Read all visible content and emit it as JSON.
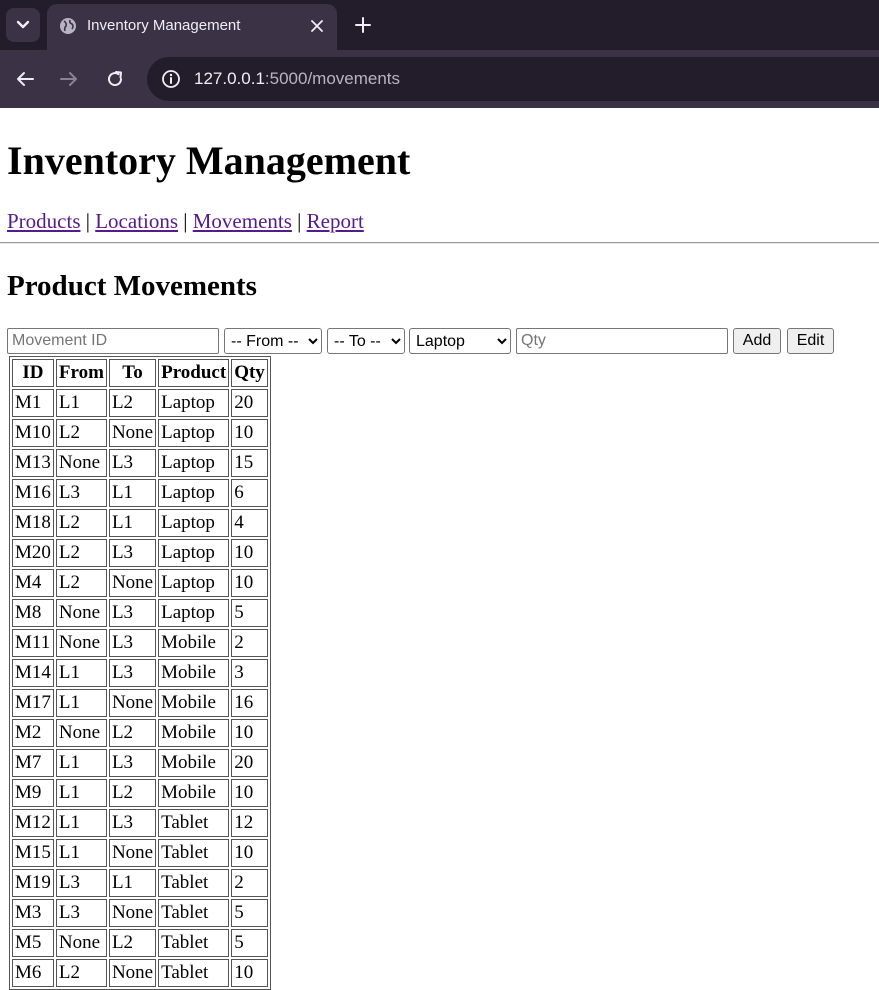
{
  "browser": {
    "tab_title": "Inventory Management",
    "url_host": "127.0.0.1",
    "url_path": ":5000/movements",
    "colors": {
      "frame": "#231d2b",
      "toolbar": "#3b3345",
      "text": "#f1ecf6"
    }
  },
  "page": {
    "heading": "Inventory Management",
    "nav": {
      "products": "Products",
      "locations": "Locations",
      "movements": "Movements",
      "report": "Report",
      "separator": "|"
    },
    "section_heading": "Product Movements",
    "form": {
      "movement_id_placeholder": "Movement ID",
      "from_selected": "-- From --",
      "to_selected": "-- To --",
      "product_selected": "Laptop",
      "qty_placeholder": "Qty",
      "add_label": "Add",
      "edit_label": "Edit"
    },
    "table": {
      "headers": [
        "ID",
        "From",
        "To",
        "Product",
        "Qty"
      ],
      "rows": [
        [
          "M1",
          "L1",
          "L2",
          "Laptop",
          "20"
        ],
        [
          "M10",
          "L2",
          "None",
          "Laptop",
          "10"
        ],
        [
          "M13",
          "None",
          "L3",
          "Laptop",
          "15"
        ],
        [
          "M16",
          "L3",
          "L1",
          "Laptop",
          "6"
        ],
        [
          "M18",
          "L2",
          "L1",
          "Laptop",
          "4"
        ],
        [
          "M20",
          "L2",
          "L3",
          "Laptop",
          "10"
        ],
        [
          "M4",
          "L2",
          "None",
          "Laptop",
          "10"
        ],
        [
          "M8",
          "None",
          "L3",
          "Laptop",
          "5"
        ],
        [
          "M11",
          "None",
          "L3",
          "Mobile",
          "2"
        ],
        [
          "M14",
          "L1",
          "L3",
          "Mobile",
          "3"
        ],
        [
          "M17",
          "L1",
          "None",
          "Mobile",
          "16"
        ],
        [
          "M2",
          "None",
          "L2",
          "Mobile",
          "10"
        ],
        [
          "M7",
          "L1",
          "L3",
          "Mobile",
          "20"
        ],
        [
          "M9",
          "L1",
          "L2",
          "Mobile",
          "10"
        ],
        [
          "M12",
          "L1",
          "L3",
          "Tablet",
          "12"
        ],
        [
          "M15",
          "L1",
          "None",
          "Tablet",
          "10"
        ],
        [
          "M19",
          "L3",
          "L1",
          "Tablet",
          "2"
        ],
        [
          "M3",
          "L3",
          "None",
          "Tablet",
          "5"
        ],
        [
          "M5",
          "None",
          "L2",
          "Tablet",
          "5"
        ],
        [
          "M6",
          "L2",
          "None",
          "Tablet",
          "10"
        ]
      ]
    },
    "colors": {
      "visited_link": "#551a8b"
    }
  }
}
